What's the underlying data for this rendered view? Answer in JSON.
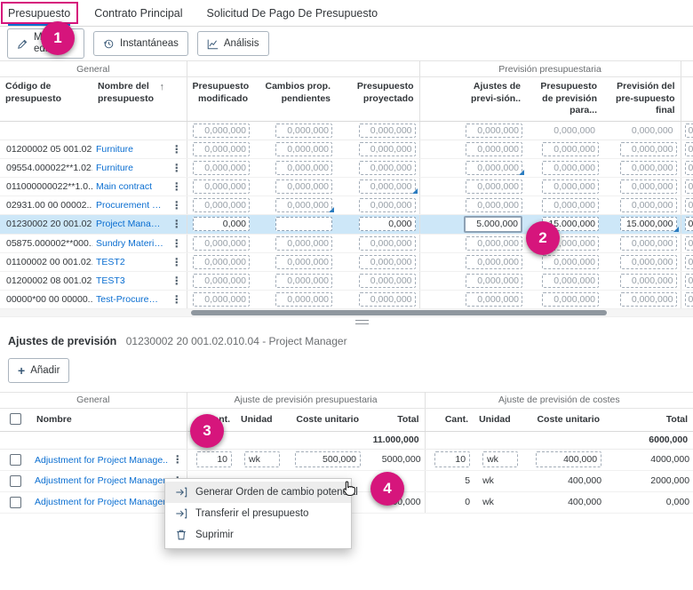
{
  "colors": {
    "annotation": "#d6157c",
    "link": "#0a6ed1",
    "selected": "#cde7f8",
    "marker": "#2b7cc0"
  },
  "tabs": [
    {
      "label": "Presupuesto",
      "active": true
    },
    {
      "label": "Contrato Principal",
      "active": false
    },
    {
      "label": "Solicitud De Pago De Presupuesto",
      "active": false
    }
  ],
  "toolbar": {
    "edit": "Modo edición",
    "snapshots": "Instantáneas",
    "analysis": "Análisis"
  },
  "icons": {
    "edit": "pencil-icon",
    "snapshots": "history-icon",
    "analysis": "chart-icon",
    "sort": "sort-ascending-icon",
    "overflow": "overflow-menu-icon",
    "marker": "changed-marker-icon",
    "cursor": "cursor-hand-icon",
    "menu": [
      "generate-change-order-icon",
      "transfer-budget-icon",
      "delete-icon"
    ]
  },
  "main_table": {
    "groups": [
      "General",
      "Previsión presupuestaria"
    ],
    "headers": {
      "code": "Código de presupuesto",
      "name": "Nombre del presupuesto",
      "modified": "Presupuesto modificado",
      "pending": "Cambios prop. pendientes",
      "projected": "Presupuesto proyectado",
      "adjustments": "Ajustes de previ-sión..",
      "forecast": "Presupuesto de previsión para...",
      "final": "Previsión del pre-supuesto final"
    },
    "filter_row": {
      "modified": "0,000,000",
      "pending": "0,000,000",
      "projected": "0,000,000",
      "adjustments": "0,000,000",
      "forecast": "0,000,000",
      "final": "0,000,000"
    },
    "clipped_placeholder": "0,000,000",
    "rows": [
      {
        "code": "01200002 05 001.02...",
        "name": "Furniture",
        "values": [
          "0,000,000",
          "0,000,000",
          "0,000,000",
          "0,000,000",
          "0,000,000",
          "0,000,000"
        ],
        "marker": null,
        "selected": false
      },
      {
        "code": "09554.000022**1.02...",
        "name": "Furniture",
        "values": [
          "0,000,000",
          "0,000,000",
          "0,000,000",
          "0,000,000",
          "0,000,000",
          "0,000,000"
        ],
        "marker": 3,
        "selected": false
      },
      {
        "code": "011000000022**1.0...",
        "name": "Main contract",
        "values": [
          "0,000,000",
          "0,000,000",
          "0,000,000",
          "0,000,000",
          "0,000,000",
          "0,000,000"
        ],
        "marker": 2,
        "selected": false
      },
      {
        "code": "02931.00 00 00002...",
        "name": "Procurement and C...",
        "values": [
          "0,000,000",
          "0,000,000",
          "0,000,000",
          "0,000,000",
          "0,000,000",
          "0,000,000"
        ],
        "marker": 1,
        "selected": false
      },
      {
        "code": "01230002 20 001.02...",
        "name": "Project Manager",
        "values": [
          "0,000",
          "",
          "0,000",
          "5.000,000",
          "15.000,000",
          "15.000,000"
        ],
        "marker": 5,
        "selected": true
      },
      {
        "code": "05875.000002**000...",
        "name": "Sundry Materials",
        "values": [
          "0,000,000",
          "0,000,000",
          "0,000,000",
          "0,000,000",
          "0,000,000",
          "0,000,000"
        ],
        "marker": null,
        "selected": false
      },
      {
        "code": "01100002 00 001.02...",
        "name": "TEST2",
        "values": [
          "0,000,000",
          "0,000,000",
          "0,000,000",
          "0,000,000",
          "0,000,000",
          "0,000,000"
        ],
        "marker": null,
        "selected": false
      },
      {
        "code": "01200002 08 001.02...",
        "name": "TEST3",
        "values": [
          "0,000,000",
          "0,000,000",
          "0,000,000",
          "0,000,000",
          "0,000,000",
          "0,000,000"
        ],
        "marker": null,
        "selected": false
      },
      {
        "code": "00000*00 00 00000...",
        "name": "Test-Procurement ...",
        "values": [
          "0,000,000",
          "0,000,000",
          "0,000,000",
          "0,000,000",
          "0,000,000",
          "0,000,000"
        ],
        "marker": null,
        "selected": false
      }
    ]
  },
  "detail": {
    "title": "Ajustes de previsión",
    "subtitle": "01230002 20 001.02.010.04 - Project Manager",
    "add_button": "Añadir"
  },
  "adjustments_table": {
    "groups": [
      "General",
      "Ajuste de previsión presupuestaria",
      "Ajuste de previsión de costes"
    ],
    "name_header": "Nombre",
    "sub_headers": [
      "Cant.",
      "Unidad",
      "Coste unitario",
      "Total"
    ],
    "totals": {
      "budget_total": "11.000,000",
      "cost_total": "6000,000"
    },
    "rows": [
      {
        "name": "Adjustment for Project Manage...",
        "pencil": true,
        "boxed": true,
        "budget": [
          "10",
          "wk",
          "500,000",
          "5000,000"
        ],
        "cost": [
          "10",
          "wk",
          "400,000",
          "4000,000"
        ]
      },
      {
        "name": "Adjustment for Project Manager 2",
        "pencil": false,
        "boxed": false,
        "budget": [
          "",
          "",
          "",
          ""
        ],
        "cost": [
          "5",
          "wk",
          "400,000",
          "2000,000"
        ]
      },
      {
        "name": "Adjustment for Project Manager 3",
        "pencil": false,
        "boxed": false,
        "budget": [
          "",
          "",
          "",
          "4000,000"
        ],
        "cost": [
          "0",
          "wk",
          "400,000",
          "0,000"
        ]
      }
    ]
  },
  "context_menu": {
    "items": [
      {
        "label": "Generar Orden de cambio potencial",
        "icon": "generate-change-order-icon",
        "highlighted": true
      },
      {
        "label": "Transferir el presupuesto",
        "icon": "transfer-budget-icon",
        "highlighted": false
      },
      {
        "label": "Suprimir",
        "icon": "delete-icon",
        "highlighted": false
      }
    ]
  },
  "annotations": {
    "badges": [
      "1",
      "2",
      "3",
      "4"
    ]
  }
}
